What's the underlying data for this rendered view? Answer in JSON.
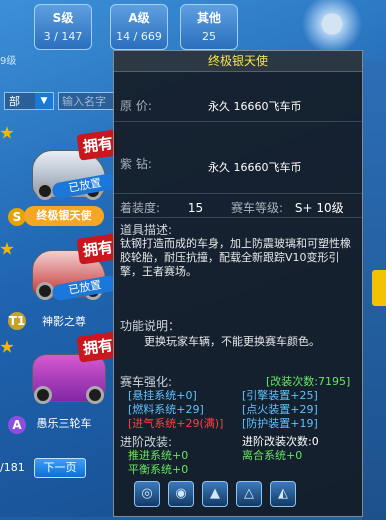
{
  "stats": [
    {
      "label": "S级",
      "value": "3 / 147"
    },
    {
      "label": "A级",
      "value": "14 / 669"
    },
    {
      "label": "其他",
      "value": "25"
    }
  ],
  "left_level_fragment": "9级",
  "filter": {
    "dropdown_value": "部",
    "search_placeholder": "输入名字"
  },
  "cards": [
    {
      "owned_badge": "拥有",
      "placed_badge": "已放置",
      "name": "终极银天使",
      "grade": "S",
      "selected": true
    },
    {
      "owned_badge": "拥有",
      "placed_badge": "已放置",
      "name": "神影之尊",
      "grade": "T1",
      "selected": false
    },
    {
      "owned_badge": "拥有",
      "placed_badge": "",
      "name": "愚乐三轮车",
      "grade": "A",
      "selected": false
    }
  ],
  "pager": {
    "count": "/181",
    "next_label": "下一页"
  },
  "tooltip": {
    "title": "终极银天使",
    "original_price_label": "原  价:",
    "original_price": "永久   16660飞车币",
    "purple_label": "紫  钻:",
    "purple_price": "永久   16660飞车币",
    "equip_label": "着装度:",
    "equip_value": "15",
    "level_label": "赛车等级:",
    "level_value": "S+ 10级",
    "desc_label": "道具描述:",
    "desc_text": "钛钢打造而成的车身，加上防震玻璃和可塑性橡胶轮胎，耐压抗撞，配载全新跟踪V10变形引擎，王者赛场。",
    "func_label": "功能说明：",
    "func_text": "更换玩家车辆，不能更换赛车颜色。",
    "enhance_label": "赛车强化:",
    "enhance_count": "[改装次数:7195]",
    "enhance_left": [
      "[悬挂系统+0]",
      "[燃料系统+29]",
      "[进气系统+29(满)]"
    ],
    "enhance_right": [
      "[引擎装置+25]",
      "[点火装置+29]",
      "[防护装置+19]"
    ],
    "advanced_label": "进阶改装:",
    "advanced_count": "进阶改装次数:0",
    "advanced_left": [
      "推进系统+0",
      "平衡系统+0"
    ],
    "advanced_right": [
      "离合系统+0"
    ],
    "icons": [
      "spin-icon",
      "swirl-icon",
      "wing-icon",
      "tri-icon",
      "fin-icon"
    ]
  }
}
